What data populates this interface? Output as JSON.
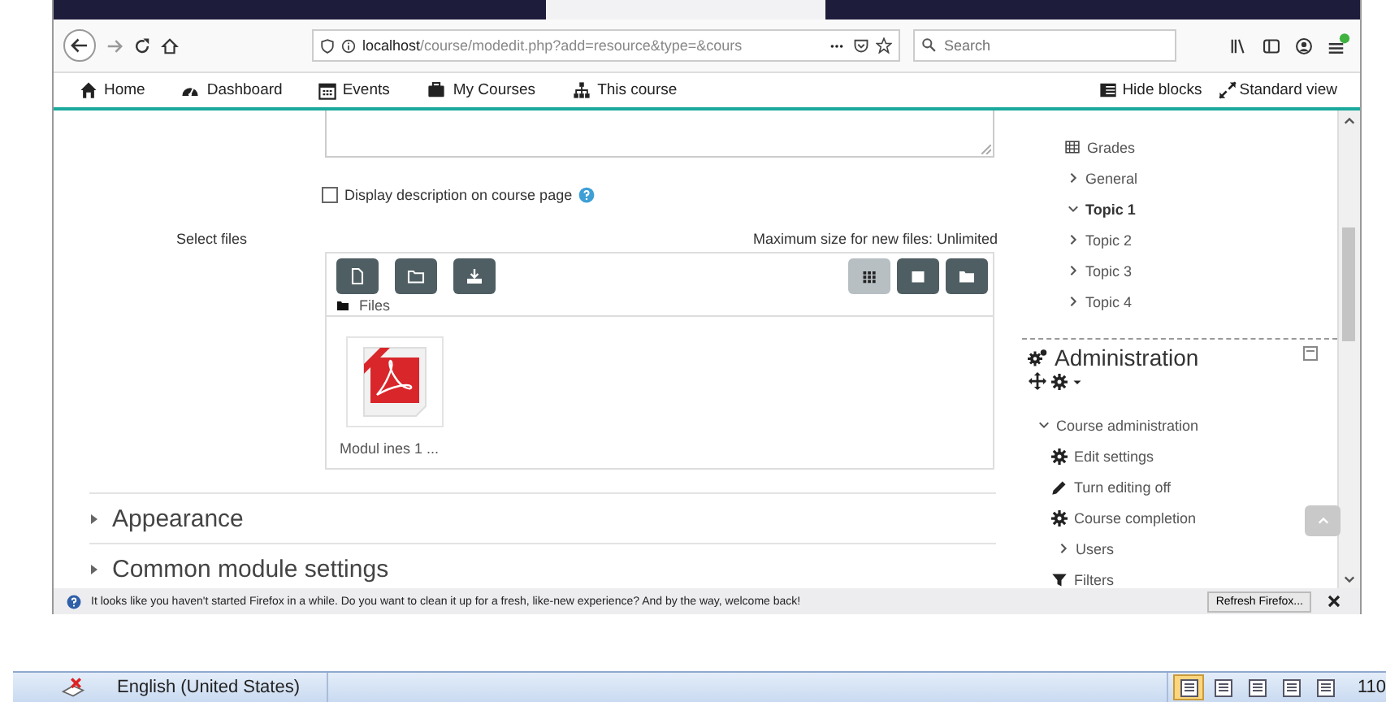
{
  "browser": {
    "url_host": "localhost",
    "url_path": "/course/modedit.php?add=resource&type=&cours",
    "search_placeholder": "Search"
  },
  "navbar": {
    "links": [
      {
        "label": "Home"
      },
      {
        "label": "Dashboard"
      },
      {
        "label": "Events"
      },
      {
        "label": "My Courses"
      },
      {
        "label": "This course"
      }
    ],
    "actions": [
      {
        "label": "Hide blocks"
      },
      {
        "label": "Standard view"
      }
    ]
  },
  "form": {
    "display_description": {
      "label": "Display description on course page",
      "checked": false
    },
    "select_files": {
      "label": "Select files",
      "max_size": "Maximum size for new files: Unlimited",
      "breadcrumb": "Files",
      "actions": [
        {
          "kind": "add-file"
        },
        {
          "kind": "create-folder"
        },
        {
          "kind": "download"
        }
      ],
      "view_modes": [
        {
          "kind": "icons",
          "selected": true
        },
        {
          "kind": "list",
          "selected": false
        },
        {
          "kind": "tree",
          "selected": false
        }
      ],
      "files": [
        {
          "name": "Modul ines 1 ..."
        }
      ]
    },
    "sections": [
      {
        "title": "Appearance",
        "expanded": false
      },
      {
        "title": "Common module settings",
        "expanded": false
      }
    ]
  },
  "navigation": {
    "items": [
      {
        "label": "Grades",
        "kind": "link"
      },
      {
        "label": "General",
        "kind": "section",
        "expanded": false
      },
      {
        "label": "Topic 1",
        "kind": "section",
        "expanded": true
      },
      {
        "label": "Topic 2",
        "kind": "section",
        "expanded": false
      },
      {
        "label": "Topic 3",
        "kind": "section",
        "expanded": false
      },
      {
        "label": "Topic 4",
        "kind": "section",
        "expanded": false
      }
    ]
  },
  "administration": {
    "title": "Administration",
    "group": {
      "label": "Course administration",
      "expanded": true,
      "children": [
        {
          "label": "Edit settings",
          "kind": "link"
        },
        {
          "label": "Turn editing off",
          "kind": "link"
        },
        {
          "label": "Course completion",
          "kind": "link"
        },
        {
          "label": "Users",
          "kind": "section",
          "expanded": false
        },
        {
          "label": "Filters",
          "kind": "link"
        }
      ]
    }
  },
  "notification": {
    "message": "It looks like you haven't started Firefox in a while. Do you want to clean it up for a fresh, like-new experience? And by the way, welcome back!",
    "button": "Refresh Firefox..."
  },
  "status_bar": {
    "language": "English (United States)",
    "view_buttons": [
      {
        "selected": true
      },
      {
        "selected": false
      },
      {
        "selected": false
      },
      {
        "selected": false
      },
      {
        "selected": false
      }
    ],
    "zoom": "110"
  }
}
